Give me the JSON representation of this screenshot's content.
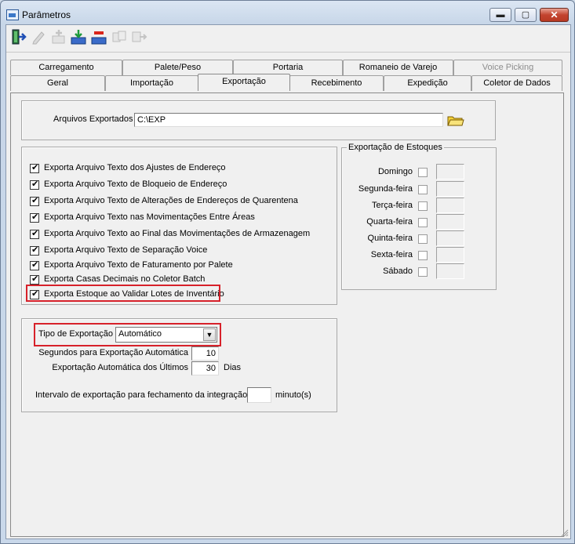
{
  "window": {
    "title": "Parâmetros"
  },
  "titlebar_buttons": {
    "minimize": "▬",
    "maximize": "▢",
    "close": "✕"
  },
  "toolbar": {
    "items": [
      {
        "name": "exit-icon",
        "enabled": true
      },
      {
        "name": "edit-pencil-icon",
        "enabled": false
      },
      {
        "name": "add-icon",
        "enabled": false
      },
      {
        "name": "download-save-icon",
        "enabled": true
      },
      {
        "name": "delete-icon",
        "enabled": true
      },
      {
        "name": "copy-icon",
        "enabled": false
      },
      {
        "name": "export-icon",
        "enabled": false
      }
    ]
  },
  "tabs": {
    "row1": [
      "Carregamento",
      "Palete/Peso",
      "Portaria",
      "Romaneio de Varejo",
      "Voice Picking"
    ],
    "row2": [
      "Geral",
      "Importação",
      "Exportação",
      "Recebimento",
      "Expedição",
      "Coletor de Dados"
    ],
    "active": "Exportação"
  },
  "arquivos": {
    "label": "Arquivos Exportados",
    "value": "C:\\EXP"
  },
  "checkboxes": [
    {
      "label": "Exporta Arquivo Texto dos Ajustes de Endereço",
      "checked": true
    },
    {
      "label": "Exporta Arquivo Texto de Bloqueio de Endereço",
      "checked": true
    },
    {
      "label": "Exporta Arquivo Texto de Alterações de Endereços de Quarentena",
      "checked": true
    },
    {
      "label": "Exporta Arquivo Texto nas Movimentações Entre Áreas",
      "checked": true
    },
    {
      "label": "Exporta Arquivo Texto ao Final das Movimentações de Armazenagem",
      "checked": true
    },
    {
      "label": "Exporta Arquivo Texto de Separação Voice",
      "checked": true
    },
    {
      "label": "Exporta Arquivo Texto de Faturamento por Palete",
      "checked": true
    },
    {
      "label": "Exporta Casas Decimais no Coletor Batch",
      "checked": true
    },
    {
      "label": "Exporta Estoque ao Validar Lotes de Inventário",
      "checked": true
    }
  ],
  "estoques": {
    "legend": "Exportação de Estoques",
    "days": [
      "Domingo",
      "Segunda-feira",
      "Terça-feira",
      "Quarta-feira",
      "Quinta-feira",
      "Sexta-feira",
      "Sábado"
    ]
  },
  "tipo": {
    "label": "Tipo de Exportação",
    "value": "Automático",
    "arrow": "▼",
    "segundos_label": "Segundos para Exportação Automática",
    "segundos_value": "10",
    "ultimos_label": "Exportação Automática dos Últimos",
    "ultimos_value": "30",
    "ultimos_unit": "Dias",
    "intervalo_label": "Intervalo de exportação para fechamento da integração",
    "intervalo_value": "",
    "intervalo_unit": "minuto(s)"
  },
  "colors": {
    "highlight": "#d7212a",
    "close_button": "#c3442f",
    "background": "#f0f0f0"
  }
}
